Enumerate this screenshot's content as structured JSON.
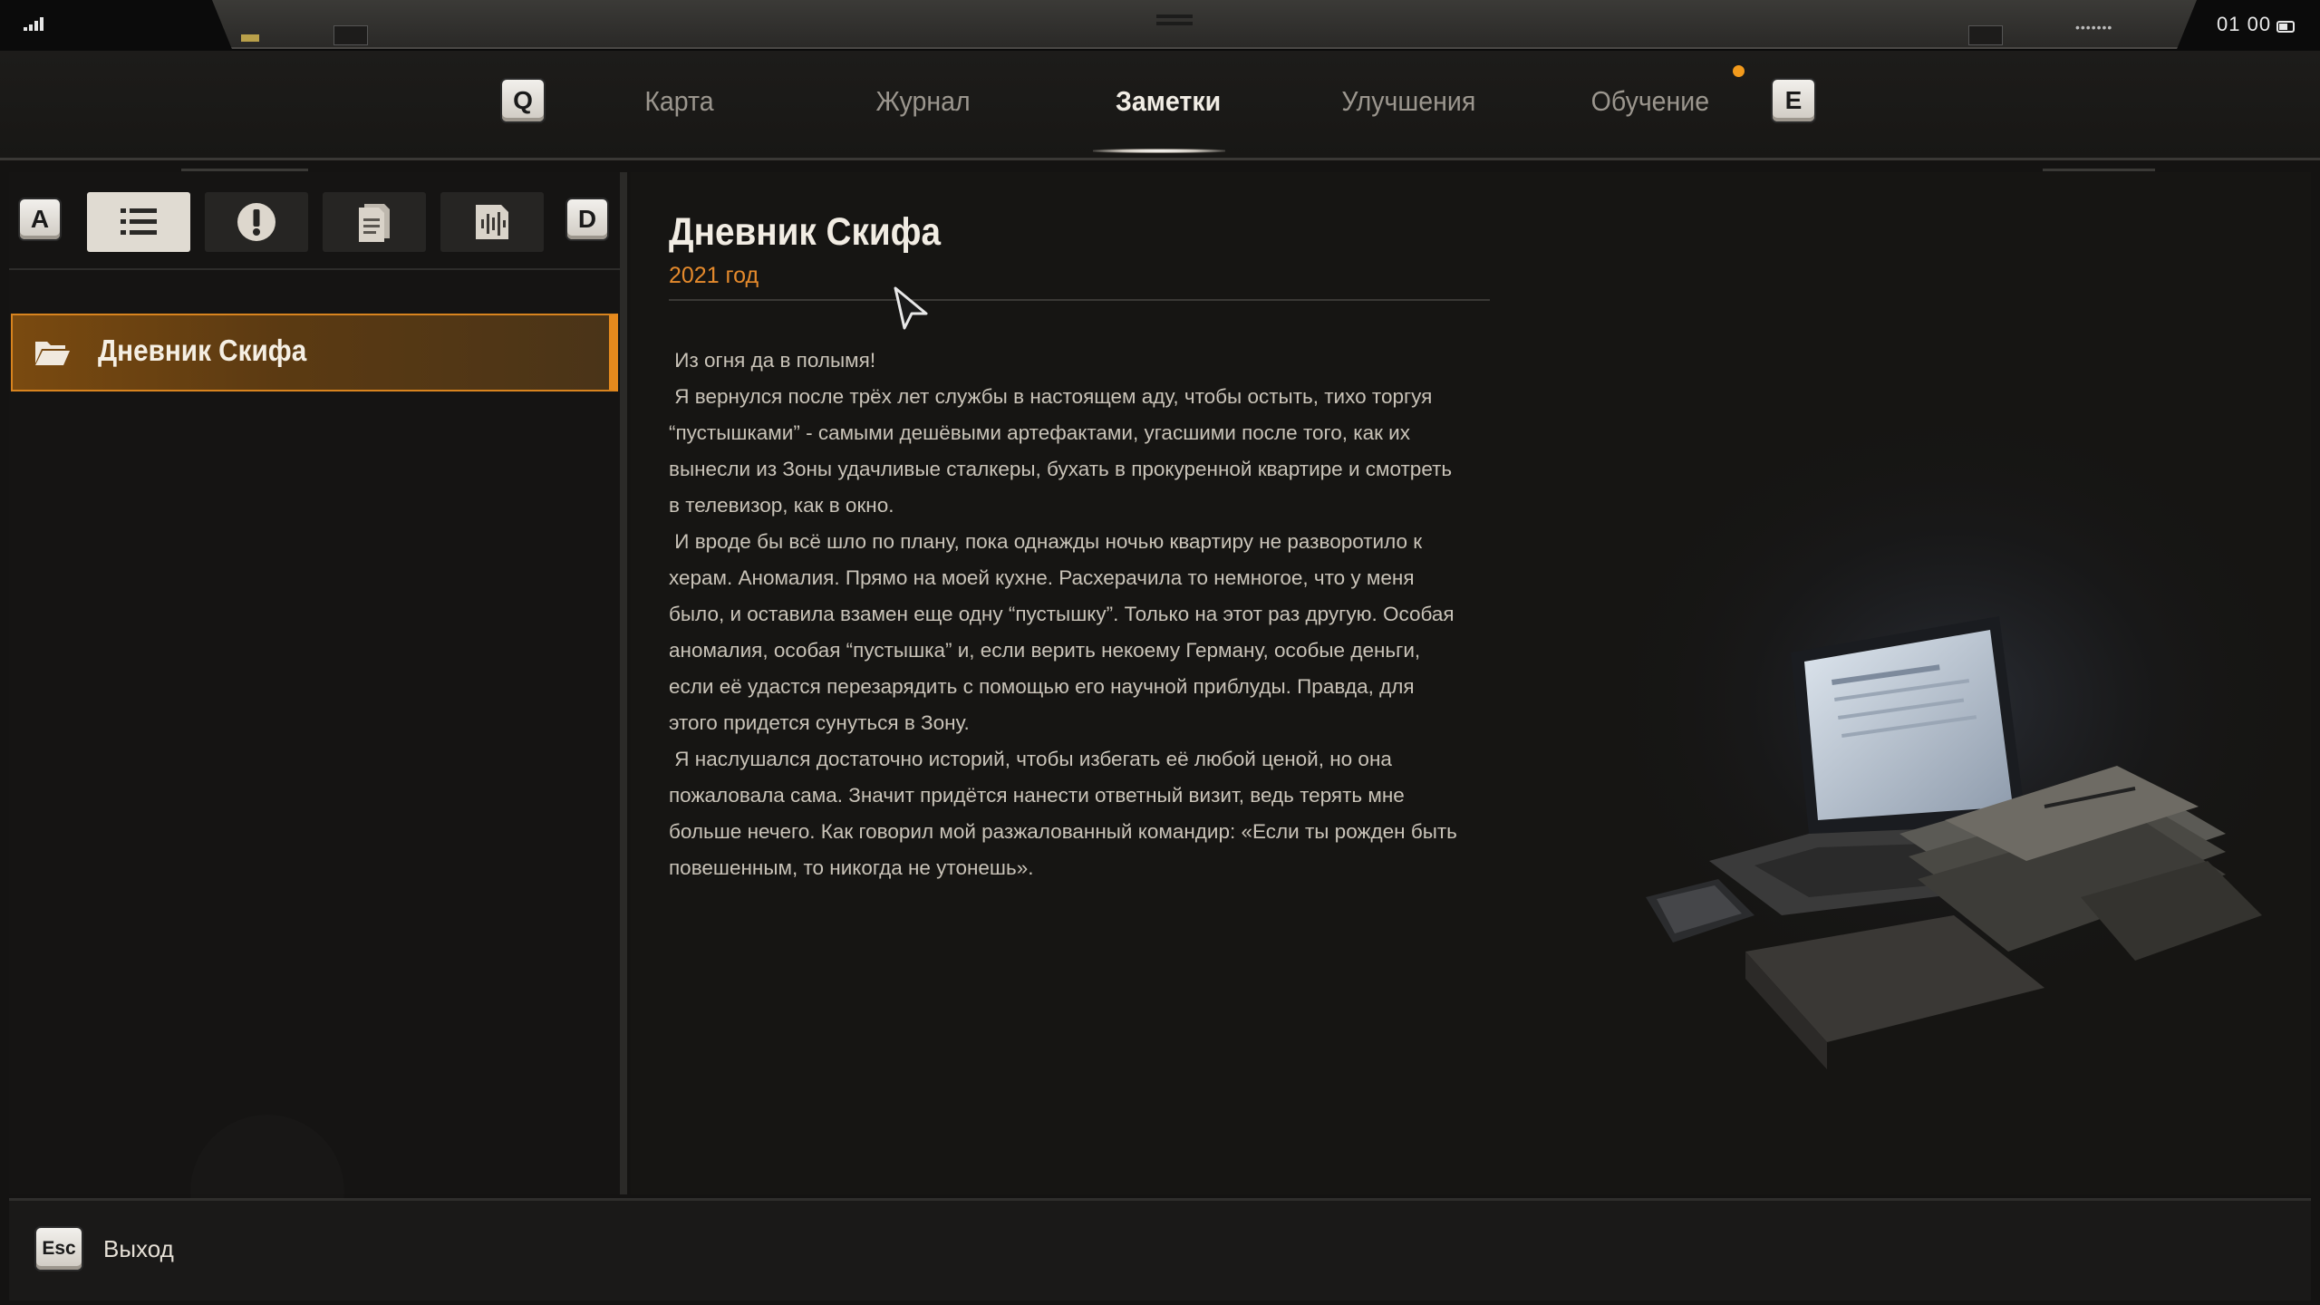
{
  "status": {
    "time": "01 00",
    "signal_icon": "signal-bars-icon",
    "battery_icon": "battery-icon"
  },
  "tabs": {
    "prev_key": "Q",
    "next_key": "E",
    "items": [
      {
        "label": "Карта",
        "active": false
      },
      {
        "label": "Журнал",
        "active": false
      },
      {
        "label": "Заметки",
        "active": true
      },
      {
        "label": "Улучшения",
        "active": false
      },
      {
        "label": "Обучение",
        "active": false,
        "notification": true
      }
    ]
  },
  "filters": {
    "prev_key": "A",
    "next_key": "D",
    "items": [
      {
        "icon": "list-icon",
        "active": true
      },
      {
        "icon": "exclamation-icon",
        "active": false
      },
      {
        "icon": "document-icon",
        "active": false
      },
      {
        "icon": "audio-icon",
        "active": false
      }
    ]
  },
  "notes_list": [
    {
      "label": "Дневник Скифа",
      "icon": "folder-open-icon",
      "selected": true
    }
  ],
  "note": {
    "title": "Дневник Скифа",
    "date": "2021 год",
    "paragraphs": [
      " Из огня да в полымя!",
      " Я вернулся после трёх лет службы в настоящем аду, чтобы остыть, тихо торгуя “пустышками” - самыми дешёвыми артефактами, угасшими после того, как их вынесли из Зоны удачливые сталкеры, бухать в прокуренной квартире и смотреть в телевизор, как в окно.",
      " И вроде бы всё шло по плану, пока однажды ночью квартиру не разворотило к херам. Аномалия. Прямо на моей кухне. Расхерачила то немногое, что у меня было, и оставила взамен еще одну “пустышку”. Только на этот раз другую. Особая аномалия, особая “пустышка” и, если верить некоему Герману, особые деньги, если её удастся перезарядить с помощью его научной приблуды. Правда, для этого придется сунуться в Зону.",
      " Я наслушался достаточно историй, чтобы избегать её любой ценой, но она пожаловала сама. Значит придётся нанести ответный визит, ведь терять мне больше нечего. Как говорил мой разжалованный командир: «Если ты рожден быть повешенным, то никогда не утонешь»."
    ]
  },
  "footer": {
    "esc_key": "Esc",
    "exit_label": "Выход"
  },
  "colors": {
    "accent": "#e5891d",
    "date": "#e58a2c",
    "background": "#141312"
  }
}
